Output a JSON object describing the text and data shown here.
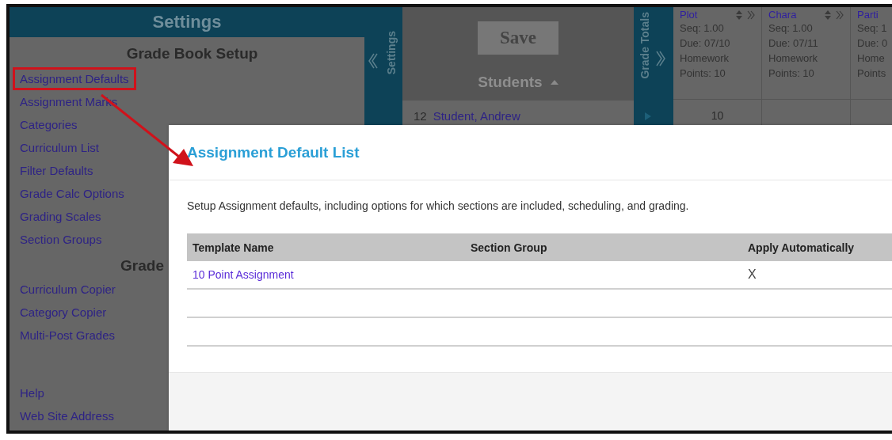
{
  "sidebar": {
    "title": "Settings",
    "sections": [
      {
        "title": "Grade Book Setup",
        "items": [
          {
            "label": "Assignment Defaults",
            "annotated": true
          },
          {
            "label": "Assignment Marks",
            "annotated": false
          },
          {
            "label": "Categories",
            "annotated": false
          },
          {
            "label": "Curriculum List",
            "annotated": false
          },
          {
            "label": "Filter Defaults",
            "annotated": false
          },
          {
            "label": "Grade Calc Options",
            "annotated": false
          },
          {
            "label": "Grading Scales",
            "annotated": false
          },
          {
            "label": "Section Groups",
            "annotated": false
          }
        ]
      },
      {
        "title": "Grade",
        "items": [
          {
            "label": "Curriculum Copier",
            "annotated": false
          },
          {
            "label": "Category Copier",
            "annotated": false
          },
          {
            "label": "Multi-Post Grades",
            "annotated": false
          }
        ]
      },
      {
        "items": [
          {
            "label": "Help",
            "annotated": false
          },
          {
            "label": "Web Site Address",
            "annotated": false
          }
        ]
      }
    ]
  },
  "settings_tab": {
    "label": "Settings"
  },
  "students": {
    "save_button": "Save",
    "header": "Students",
    "rows": [
      {
        "number": "12",
        "name": "Student, Andrew"
      }
    ]
  },
  "grade_totals_tab": {
    "label": "Grade Totals"
  },
  "assignments": [
    {
      "name": "Plot",
      "lines": [
        "Seq: 1.00",
        "Due: 07/10",
        "Homework",
        "Points: 10"
      ],
      "score": "10"
    },
    {
      "name": "Chara",
      "lines": [
        "Seq: 1.00",
        "Due: 07/11",
        "Homework",
        "Points: 10"
      ]
    },
    {
      "name": "Parti",
      "lines": [
        "Seq: 1",
        "Due: 0",
        "Home",
        "Points"
      ]
    }
  ],
  "dialog": {
    "title": "Assignment Default List",
    "description": "Setup Assignment defaults, including options for which sections are included, scheduling, and grading.",
    "table": {
      "columns": [
        "Template Name",
        "Section Group",
        "Apply Automatically"
      ],
      "rows": [
        {
          "template_name": "10 Point Assignment",
          "apply_automatically": "X"
        }
      ]
    }
  }
}
